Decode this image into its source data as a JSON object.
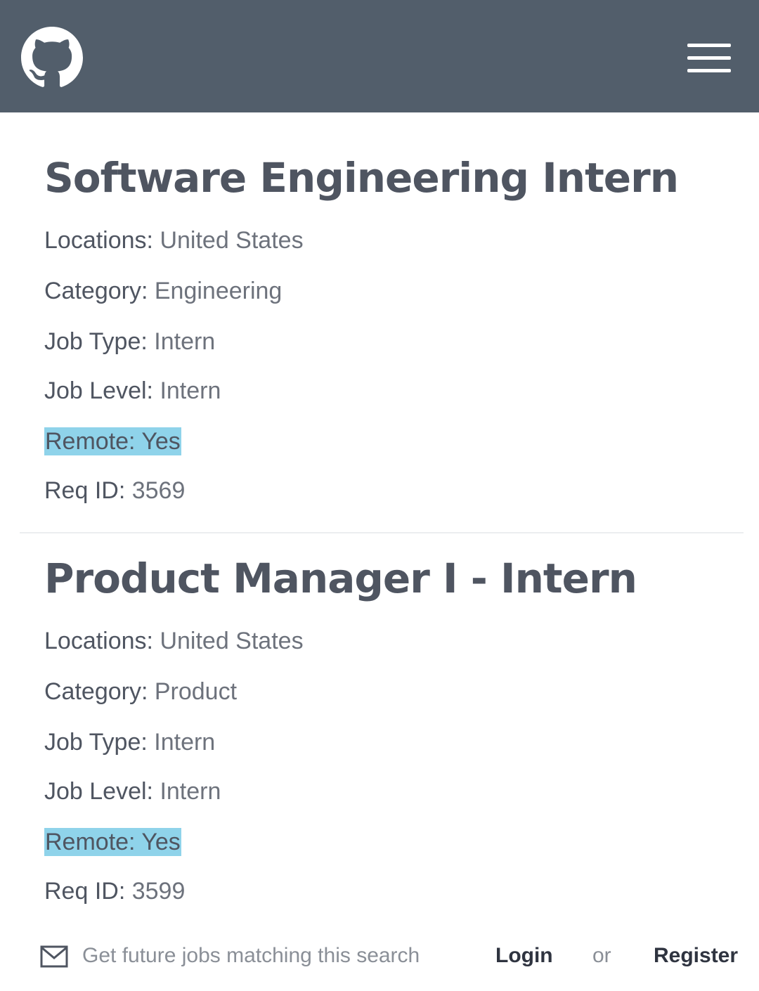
{
  "header": {
    "logo_icon": "github-octocat-icon",
    "menu_icon": "hamburger-menu-icon",
    "background_color": "#525e6b"
  },
  "jobs": [
    {
      "title": "Software Engineering Intern",
      "locations_label": "Locations:",
      "locations": "United States",
      "category_label": "Category:",
      "category": "Engineering",
      "job_type_label": "Job Type:",
      "job_type": "Intern",
      "job_level_label": "Job Level:",
      "job_level": "Intern",
      "remote_label": "Remote:",
      "remote": "Yes",
      "req_id_label": "Req ID:",
      "req_id": "3569"
    },
    {
      "title": "Product Manager I - Intern",
      "locations_label": "Locations:",
      "locations": "United States",
      "category_label": "Category:",
      "category": "Product",
      "job_type_label": "Job Type:",
      "job_type": "Intern",
      "job_level_label": "Job Level:",
      "job_level": "Intern",
      "remote_label": "Remote:",
      "remote": "Yes",
      "req_id_label": "Req ID:",
      "req_id": "3599"
    }
  ],
  "footer": {
    "mail_icon": "envelope-icon",
    "alert_text": "Get future jobs matching this search",
    "login_label": "Login",
    "or_text": "or",
    "register_label": "Register"
  },
  "highlight_color": "#8fd3ea"
}
